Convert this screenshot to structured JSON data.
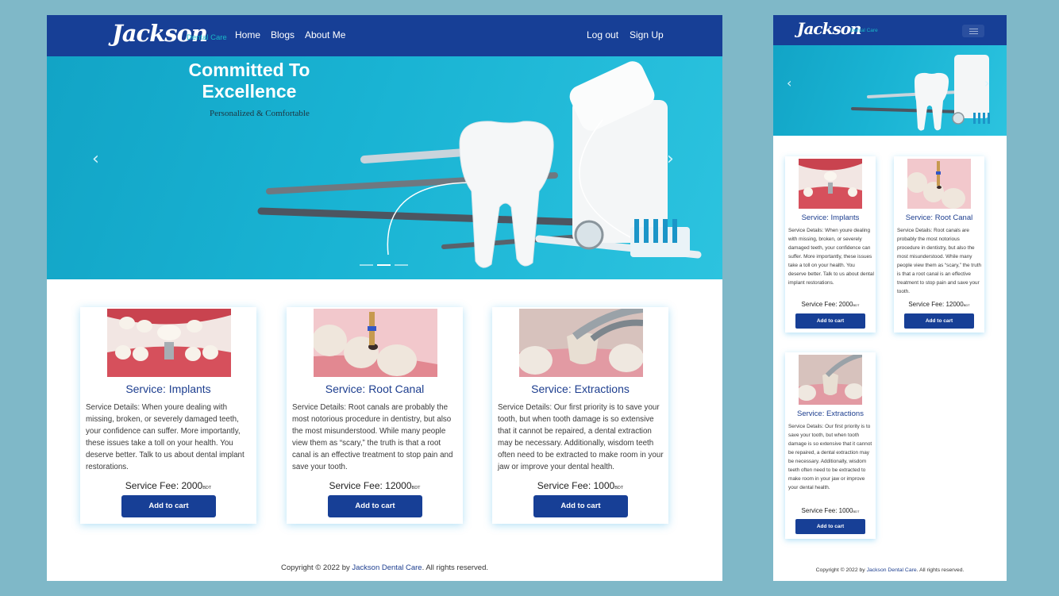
{
  "brand": {
    "logo": "Jackson",
    "logo_sub": "Dental Care"
  },
  "nav": {
    "home": "Home",
    "blogs": "Blogs",
    "about": "About Me",
    "logout": "Log out",
    "signup": "Sign Up"
  },
  "hero": {
    "title": "Committed To Excellence",
    "subtitle": "Personalized & Comfortable",
    "prev": "‹",
    "next": "›",
    "slide_count": 3,
    "active_slide": 2
  },
  "services": [
    {
      "title": "Service: Implants",
      "details": "Service Details: When youre dealing with missing, broken, or severely damaged teeth, your confidence can suffer. More importantly, these issues take a toll on your health. You deserve better. Talk to us about dental implant restorations.",
      "fee_label": "Service Fee: 2000",
      "fee_unit": "BDT",
      "button": "Add to cart"
    },
    {
      "title": "Service: Root Canal",
      "details": "Service Details: Root canals are probably the most notorious procedure in dentistry, but also the most misunderstood. While many people view them as “scary,” the truth is that a root canal is an effective treatment to stop pain and save your tooth.",
      "fee_label": "Service Fee: 12000",
      "fee_unit": "BDT",
      "button": "Add to cart"
    },
    {
      "title": "Service: Extractions",
      "details": "Service Details: Our first priority is to save your tooth, but when tooth damage is so extensive that it cannot be repaired, a dental extraction may be necessary. Additionally, wisdom teeth often need to be extracted to make room in your jaw or improve your dental health.",
      "fee_label": "Service Fee: 1000",
      "fee_unit": "BDT",
      "button": "Add to cart"
    }
  ],
  "footer": {
    "prefix": "Copyright © 2022 by ",
    "brand": "Jackson Dental Care",
    "suffix": ". All rights reserved."
  },
  "colors": {
    "primary": "#173f96",
    "accent": "#19b8c8",
    "backdrop": "#7fb8c8"
  }
}
